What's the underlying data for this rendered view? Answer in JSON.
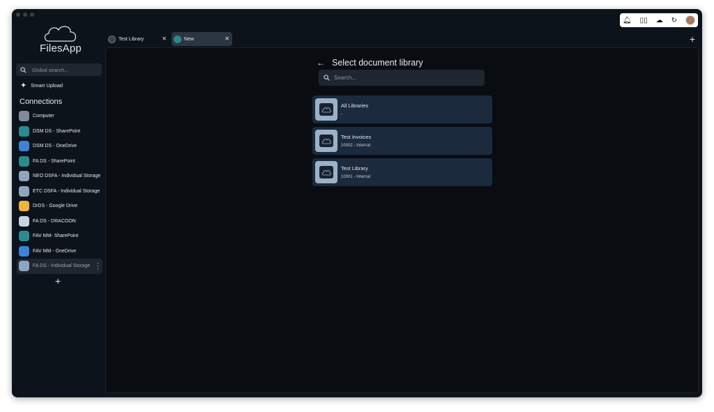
{
  "app": {
    "name": "FilesApp"
  },
  "sidebar": {
    "global_search_placeholder": "Global search...",
    "smart_upload_label": "Smart Upload",
    "connections_title": "Connections",
    "connections": [
      {
        "label": "Computer",
        "icon": "computer-icon",
        "color": "#7f8b98"
      },
      {
        "label": "DSM DS - SharePoint",
        "icon": "sharepoint-icon",
        "color": "#2b8a8f"
      },
      {
        "label": "DSM DS - OneDrive",
        "icon": "onedrive-icon",
        "color": "#3a83d8"
      },
      {
        "label": "FA DS - SharePoint",
        "icon": "sharepoint-icon",
        "color": "#2b8a8f"
      },
      {
        "label": "NEO DSFA - Individual Storage",
        "icon": "storage-icon",
        "color": "#8ea6bd"
      },
      {
        "label": "ETC DSFA - Individual Storage",
        "icon": "storage-icon",
        "color": "#8ea6bd"
      },
      {
        "label": "DrDS - Google Drive",
        "icon": "google-drive-icon",
        "color": "#e9b83a"
      },
      {
        "label": "FA DS - DRACOON",
        "icon": "dracoon-icon",
        "color": "#c8d4df"
      },
      {
        "label": "FAV MM- SharePoint",
        "icon": "sharepoint-icon",
        "color": "#2b8a8f"
      },
      {
        "label": "FAV MM - OneDrive",
        "icon": "onedrive-icon",
        "color": "#3a83d8"
      },
      {
        "label": "FA DS - Individual Storage",
        "icon": "storage-icon",
        "color": "#8ea6bd"
      }
    ]
  },
  "tabs": [
    {
      "label": "Test Library"
    },
    {
      "label": "New"
    }
  ],
  "panel": {
    "title": "Select document library",
    "search_placeholder": "Search...",
    "libraries": [
      {
        "name": "All Libraries",
        "sub": "-"
      },
      {
        "name": "Test Invoices",
        "sub": "10002 - Internal"
      },
      {
        "name": "Test Library",
        "sub": "10001 - Internal"
      }
    ]
  },
  "topbar_icons": [
    "bell-icon",
    "columns-icon",
    "cloud-icon",
    "refresh-icon",
    "avatar"
  ]
}
